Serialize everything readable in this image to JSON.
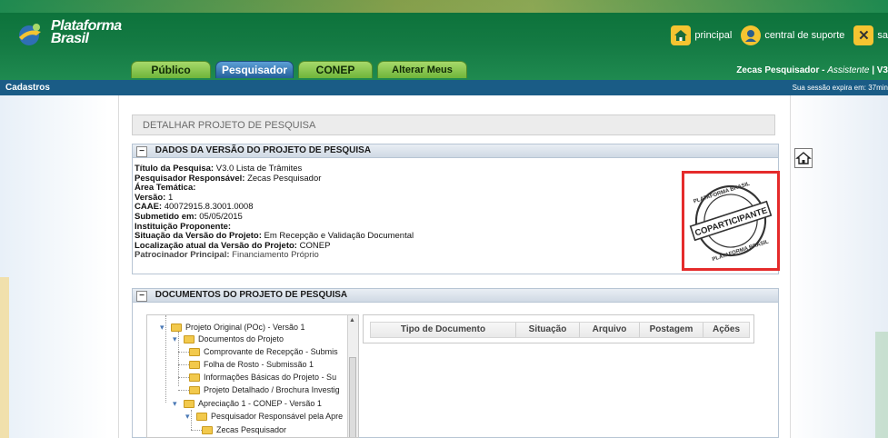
{
  "header": {
    "logo_line1": "Plataforma",
    "logo_line2": "Brasil",
    "links": [
      {
        "label": "principal",
        "icon": "home-icon"
      },
      {
        "label": "central de suporte",
        "icon": "support-icon"
      },
      {
        "label": "sa",
        "icon": "close-icon"
      }
    ],
    "tabs": [
      {
        "label": "Público",
        "active": false
      },
      {
        "label": "Pesquisador",
        "active": true
      },
      {
        "label": "CONEP",
        "active": false
      },
      {
        "label": "Alterar Meus Dados",
        "active": false
      }
    ],
    "user_name": "Zecas Pesquisador",
    "user_role": "Assistente",
    "user_version": "V3"
  },
  "navbar": {
    "left": "Cadastros",
    "session": "Sua sessão expira em: 37min"
  },
  "page": {
    "title": "DETALHAR PROJETO DE PESQUISA"
  },
  "version_panel": {
    "header": "DADOS DA VERSÃO DO PROJETO DE PESQUISA",
    "fields": [
      {
        "label": "Título da Pesquisa:",
        "value": "V3.0 Lista de Trâmites"
      },
      {
        "label": "Pesquisador Responsável:",
        "value": "Zecas Pesquisador"
      },
      {
        "label": "Área Temática:",
        "value": ""
      },
      {
        "label": "Versão:",
        "value": "1"
      },
      {
        "label": "CAAE:",
        "value": "40072915.8.3001.0008"
      },
      {
        "label": "Submetido em:",
        "value": "05/05/2015"
      },
      {
        "label": "Instituição Proponente:",
        "value": ""
      },
      {
        "label": "Situação da Versão do Projeto:",
        "value": "Em Recepção e Validação Documental"
      },
      {
        "label": "Localização atual da Versão do Projeto:",
        "value": "CONEP"
      },
      {
        "label": "Patrocinador Principal:",
        "value": "Financiamento Próprio"
      }
    ],
    "stamp": {
      "main": "COPARTICIPANTE",
      "ring_top": "PLATAFORMA BRASIL",
      "ring_bottom": "PLATAFORMA BRASIL"
    }
  },
  "docs_panel": {
    "header": "DOCUMENTOS DO PROJETO DE PESQUISA",
    "tree": [
      {
        "label": "Projeto Original (POc) - Versão 1",
        "level": 0
      },
      {
        "label": "Documentos do Projeto",
        "level": 1
      },
      {
        "label": "Comprovante de Recepção - Submis",
        "level": 2
      },
      {
        "label": "Folha de Rosto - Submissão 1",
        "level": 2
      },
      {
        "label": "Informações Básicas do Projeto - Su",
        "level": 2
      },
      {
        "label": "Projeto Detalhado / Brochura Investig",
        "level": 2
      },
      {
        "label": "Apreciação 1 - CONEP - Versão 1",
        "level": 1
      },
      {
        "label": "Pesquisador Responsável pela Apre",
        "level": 2
      },
      {
        "label": "Zecas Pesquisador",
        "level": 3
      }
    ],
    "table_columns": [
      "Tipo de Documento",
      "Situação",
      "Arquivo",
      "Postagem",
      "Ações"
    ]
  },
  "colors": {
    "header_green": "#147a43",
    "navbar_blue": "#1a5c86",
    "tab_green": "#6fb53a",
    "tab_active_blue": "#245f9a",
    "highlight_red": "#e52b2b"
  }
}
